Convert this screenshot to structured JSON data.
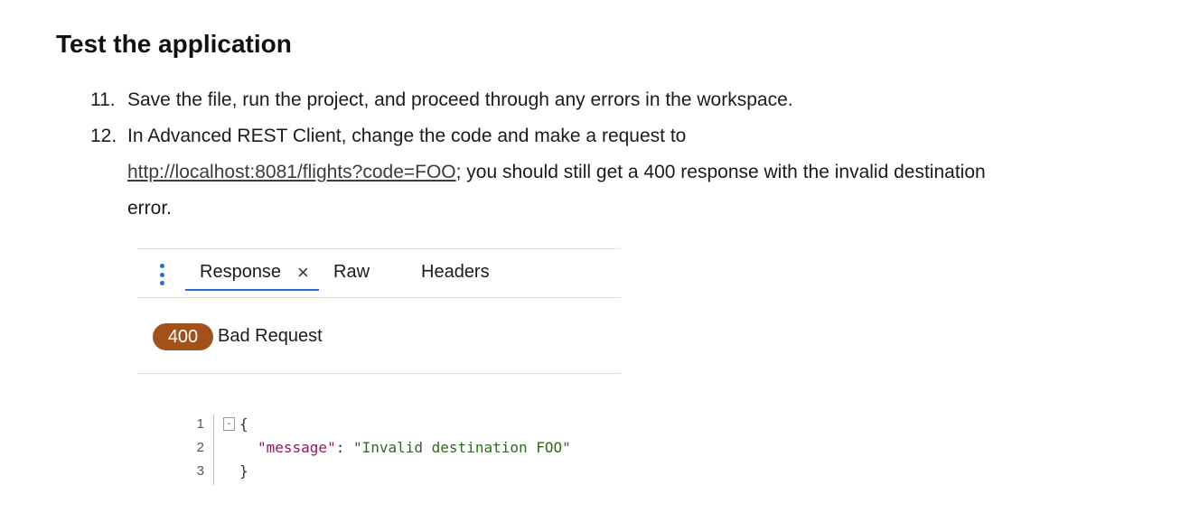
{
  "heading": "Test the application",
  "steps": [
    {
      "number": "11.",
      "text": "Save the file, run the project, and proceed through any errors in the workspace."
    },
    {
      "number": "12.",
      "text_before": "In Advanced REST Client, change the code and make a request to",
      "link": "http://localhost:8081/flights?code=FOO",
      "text_after": "; you should still get a 400 response with the invalid destination",
      "text_end": "error."
    }
  ],
  "panel": {
    "tabs": {
      "response": "Response",
      "close": "×",
      "raw": "Raw",
      "headers": "Headers"
    },
    "status_code": "400",
    "status_text": "Bad Request",
    "code": {
      "line_numbers": [
        "1",
        "2",
        "3"
      ],
      "fold": "-",
      "line1": "{",
      "key": "\"message\"",
      "colon": ": ",
      "value": "\"Invalid destination FOO\"",
      "line3": "}"
    },
    "colors": {
      "accent": "#1e6fd9",
      "status_badge": "#a1521b",
      "json_key": "#8b1a5c",
      "json_string": "#2d6a1f"
    }
  }
}
